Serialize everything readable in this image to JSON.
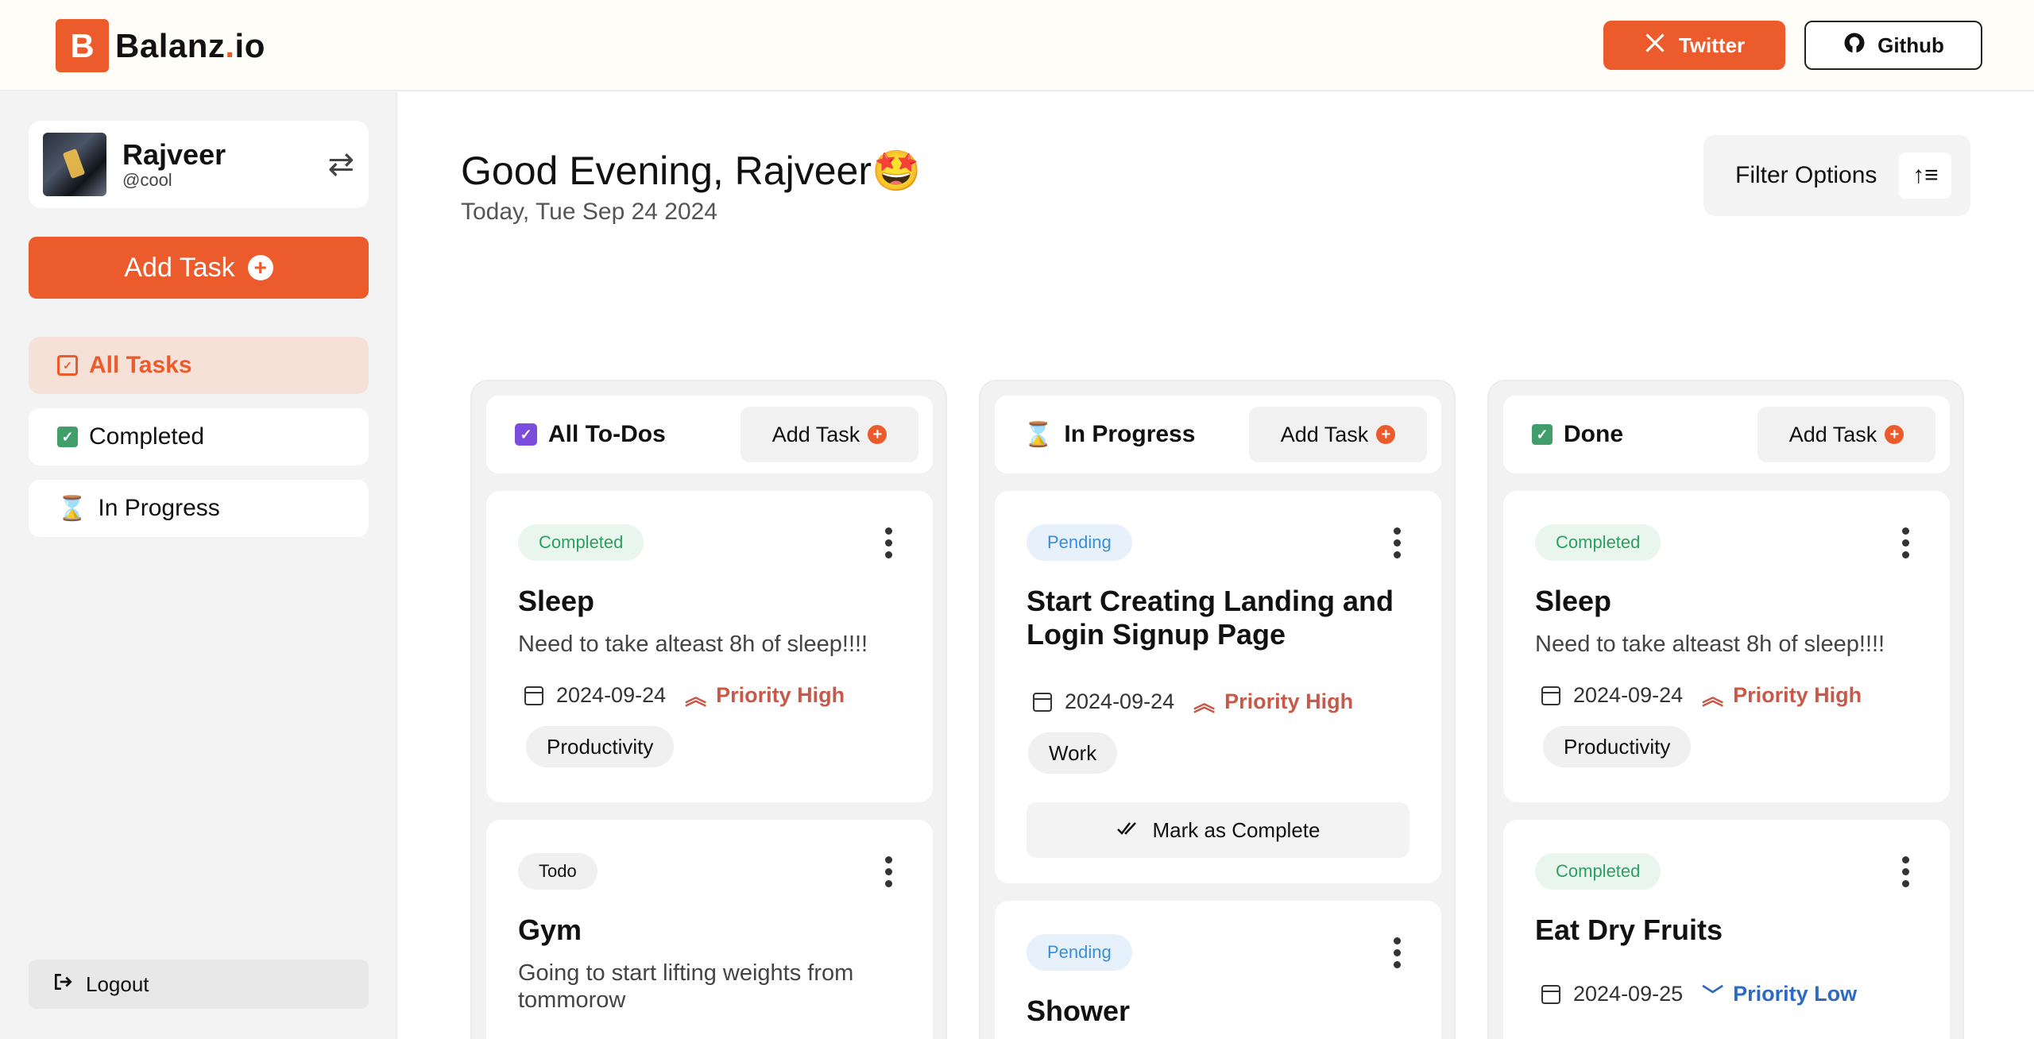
{
  "brand": {
    "letter": "B",
    "name_main": "Balanz",
    "name_dot": ".",
    "name_tld": "io"
  },
  "header": {
    "twitter_label": "Twitter",
    "github_label": "Github"
  },
  "profile": {
    "name": "Rajveer",
    "handle": "@cool"
  },
  "sidebar": {
    "add_task_label": "Add Task",
    "items": [
      {
        "label": "All Tasks",
        "icon": "calendar-check-icon",
        "active": true
      },
      {
        "label": "Completed",
        "icon": "check-square-icon",
        "active": false
      },
      {
        "label": "In Progress",
        "icon": "hourglass-icon",
        "active": false
      }
    ],
    "logout_label": "Logout"
  },
  "main": {
    "greeting": "Good Evening, Rajveer🤩",
    "date": "Today, Tue Sep 24 2024",
    "filter_label": "Filter Options"
  },
  "columns": [
    {
      "title": "All To-Dos",
      "add_label": "Add Task",
      "cards": [
        {
          "status": "Completed",
          "title": "Sleep",
          "description": "Need to take alteast 8h of sleep!!!!",
          "date": "2024-09-24",
          "priority": "Priority High",
          "tag": "Productivity"
        },
        {
          "status": "Todo",
          "title": "Gym",
          "description": "Going to start lifting weights from tommorow"
        }
      ]
    },
    {
      "title": "In Progress",
      "add_label": "Add Task",
      "cards": [
        {
          "status": "Pending",
          "title": "Start Creating Landing and Login Signup Page",
          "date": "2024-09-24",
          "priority": "Priority High",
          "tag": "Work",
          "action": "Mark as Complete"
        },
        {
          "status": "Pending",
          "title": "Shower"
        }
      ]
    },
    {
      "title": "Done",
      "add_label": "Add Task",
      "cards": [
        {
          "status": "Completed",
          "title": "Sleep",
          "description": "Need to take alteast 8h of sleep!!!!",
          "date": "2024-09-24",
          "priority": "Priority High",
          "tag": "Productivity"
        },
        {
          "status": "Completed",
          "title": "Eat Dry Fruits",
          "date": "2024-09-25",
          "priority": "Priority Low"
        }
      ]
    }
  ],
  "colors": {
    "accent": "#ec5b2b",
    "completed": "#2f9e62",
    "pending": "#3b8fd8",
    "priority_high": "#c65a4a",
    "priority_low": "#2d6ac0"
  }
}
